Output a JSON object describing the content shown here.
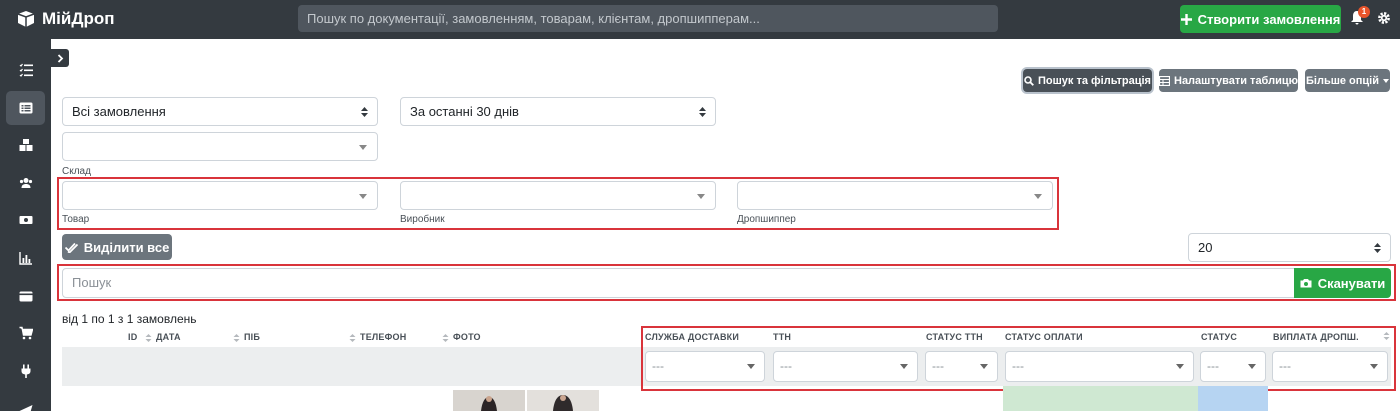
{
  "app": {
    "title": "МійДроп"
  },
  "header": {
    "search_placeholder": "Пошук по документації, замовленням, товарам, клієнтам, дропшипперам...",
    "create_order_label": "Створити замовлення",
    "notifications_count": "1"
  },
  "sidebar": {
    "items": [
      {
        "icon": "tasks-icon"
      },
      {
        "icon": "orders-list-icon",
        "active": true
      },
      {
        "icon": "warehouse-boxes-icon"
      },
      {
        "icon": "users-icon"
      },
      {
        "icon": "money-icon"
      },
      {
        "icon": "chart-icon"
      },
      {
        "icon": "wallet-icon"
      },
      {
        "icon": "cart-icon"
      },
      {
        "icon": "plug-icon"
      },
      {
        "icon": "send-icon"
      }
    ]
  },
  "toolbar": {
    "search_filter_label": "Пошук та фільтрація",
    "configure_table_label": "Налаштувати таблицю",
    "more_options_label": "Більше опцій"
  },
  "filters": {
    "orders_scope": "Всі замовлення",
    "period": "За останні 30 днів",
    "warehouse_label": "Склад",
    "product_label": "Товар",
    "manufacturer_label": "Виробник",
    "dropshipper_label": "Дропшиппер"
  },
  "actions": {
    "select_all_label": "Виділити все",
    "page_size": "20"
  },
  "search": {
    "placeholder": "Пошук",
    "scan_label": "Сканувати"
  },
  "results": {
    "count_text": "від 1 по 1 з 1 замовлень"
  },
  "table": {
    "columns": {
      "id": "ID",
      "date": "ДАТА",
      "name": "ПІБ",
      "phone": "ТЕЛЕФОН",
      "photo": "ФОТО",
      "delivery": "СЛУЖБА ДОСТАВКИ",
      "ttn": "ТТН",
      "ttn_status": "СТАТУС ТТН",
      "payment_status": "СТАТУС ОПЛАТИ",
      "status": "СТАТУС",
      "dropship_payout": "ВИПЛАТА ДРОПШ."
    },
    "filter_placeholder": "---"
  },
  "colors": {
    "topbar": "#343a40",
    "success": "#28a745",
    "secondary": "#6c757d",
    "highlight": "#d9343b"
  }
}
